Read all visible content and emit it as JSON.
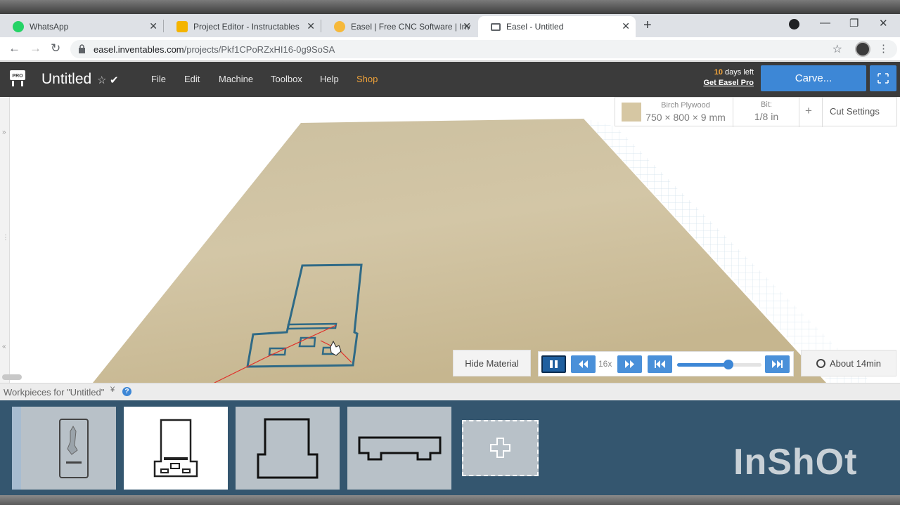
{
  "browser": {
    "tabs": [
      {
        "label": "WhatsApp",
        "icon": "whatsapp-icon",
        "color": "#25d366"
      },
      {
        "label": "Project Editor - Instructables",
        "icon": "instructables-robot-icon",
        "color": "#f4b400"
      },
      {
        "label": "Easel | Free CNC Software | Inven",
        "icon": "easel-hexagon-icon",
        "color": "#f6b93b"
      },
      {
        "label": "Easel - Untitled",
        "icon": "monitor-icon",
        "color": "#5f6368"
      }
    ],
    "url_domain": "easel.inventables.com",
    "url_path": "/projects/Pkf1CPoRZxHI16-0g9SoSA"
  },
  "header": {
    "project_title": "Untitled",
    "menu": [
      "File",
      "Edit",
      "Machine",
      "Toolbox",
      "Help",
      "Shop"
    ],
    "trial_days": "10",
    "trial_text": "days left",
    "pro_link": "Get Easel Pro",
    "carve_label": "Carve...",
    "accent_color": "#3d87d6",
    "shop_color": "#f0a33a"
  },
  "material_panel": {
    "name": "Birch Plywood",
    "dims": "750 × 800 × 9 mm",
    "bit_label": "Bit:",
    "bit_value": "1/8 in",
    "cut_settings": "Cut Settings"
  },
  "simulation": {
    "hide_material": "Hide Material",
    "speed": "16x",
    "progress": 0.61,
    "time_estimate": "About 14min"
  },
  "workpieces": {
    "label": "Workpieces for \"Untitled\"",
    "count": 4,
    "selected_index": 1,
    "watermark": "InShOt"
  }
}
